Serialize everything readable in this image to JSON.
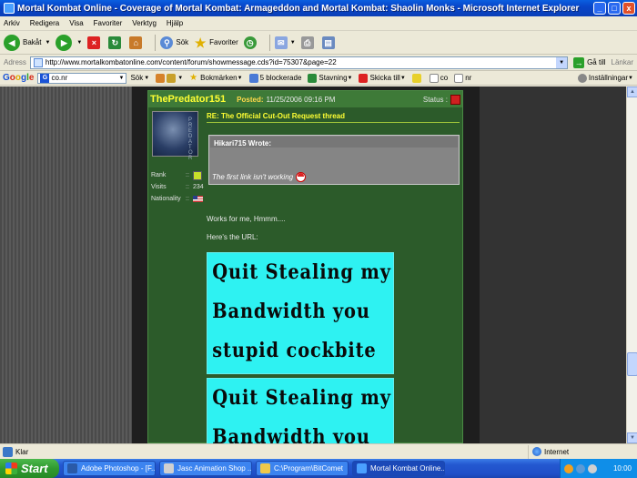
{
  "window": {
    "title": "Mortal Kombat Online - Coverage of Mortal Kombat: Armageddon and Mortal Kombat: Shaolin Monks - Microsoft Internet Explorer",
    "minimize": "_",
    "maximize": "□",
    "close": "x"
  },
  "menu": [
    "Arkiv",
    "Redigera",
    "Visa",
    "Favoriter",
    "Verktyg",
    "Hjälp"
  ],
  "toolbar": {
    "back": "Bakåt",
    "search": "Sök",
    "favorites": "Favoriter"
  },
  "address": {
    "label": "Adress",
    "url": "http://www.mortalkombatonline.com/content/forum/showmessage.cds?id=75307&page=22",
    "go": "Gå till",
    "links": "Länkar"
  },
  "google_bar": {
    "logo": [
      "G",
      "o",
      "o",
      "g",
      "l",
      "e"
    ],
    "search_value": "co.nr",
    "search_label": "Sök",
    "bookmarks": "Bokmärken",
    "blocked": "5 blockerade",
    "spelling": "Stavning",
    "send_to": "Skicka till",
    "term1": "co",
    "term2": "nr",
    "settings": "Inställningar"
  },
  "post": {
    "author": "ThePredator151",
    "posted_label": "Posted:",
    "date": "11/25/2006 09:16 PM",
    "status_label": "Status :",
    "subject": "RE: The Official Cut-Out Request thread",
    "user": {
      "rank_label": "Rank",
      "visits_label": "Visits",
      "visits": "234",
      "nationality_label": "Nationality",
      "sep": "::"
    },
    "quote": {
      "header": "Hikari715 Wrote:",
      "text": "The first link isn't working"
    },
    "line1": "Works for me, Hmmm....",
    "line2": "Here's the URL:",
    "image_lines": [
      "Quit Stealing my",
      "Bandwidth you",
      "stupid cockbite"
    ]
  },
  "status_bar": {
    "text": "Klar",
    "zone": "Internet"
  },
  "taskbar": {
    "start": "Start",
    "tasks": [
      "Adobe Photoshop - [F...",
      "Jasc Animation Shop ...",
      "C:\\Program\\BitComet",
      "Mortal Kombat Online..."
    ],
    "clock": "10:00"
  }
}
